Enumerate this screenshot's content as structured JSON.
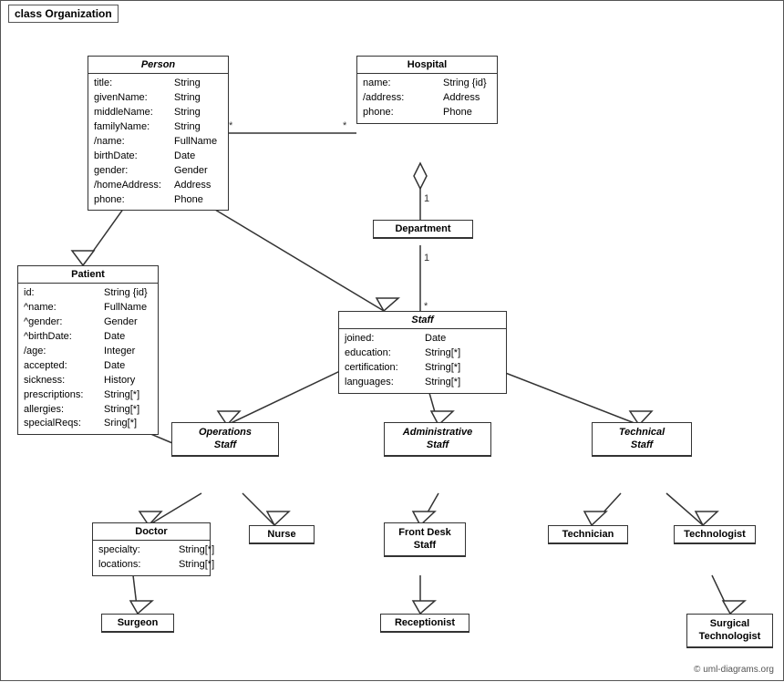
{
  "diagram": {
    "title": "class Organization",
    "copyright": "© uml-diagrams.org",
    "classes": {
      "person": {
        "name": "Person",
        "italic": true,
        "attrs": [
          {
            "name": "title:",
            "type": "String"
          },
          {
            "name": "givenName:",
            "type": "String"
          },
          {
            "name": "middleName:",
            "type": "String"
          },
          {
            "name": "familyName:",
            "type": "String"
          },
          {
            "name": "/name:",
            "type": "FullName"
          },
          {
            "name": "birthDate:",
            "type": "Date"
          },
          {
            "name": "gender:",
            "type": "Gender"
          },
          {
            "name": "/homeAddress:",
            "type": "Address"
          },
          {
            "name": "phone:",
            "type": "Phone"
          }
        ]
      },
      "hospital": {
        "name": "Hospital",
        "italic": false,
        "attrs": [
          {
            "name": "name:",
            "type": "String {id}"
          },
          {
            "name": "/address:",
            "type": "Address"
          },
          {
            "name": "phone:",
            "type": "Phone"
          }
        ]
      },
      "department": {
        "name": "Department",
        "italic": false,
        "attrs": []
      },
      "staff": {
        "name": "Staff",
        "italic": true,
        "attrs": [
          {
            "name": "joined:",
            "type": "Date"
          },
          {
            "name": "education:",
            "type": "String[*]"
          },
          {
            "name": "certification:",
            "type": "String[*]"
          },
          {
            "name": "languages:",
            "type": "String[*]"
          }
        ]
      },
      "patient": {
        "name": "Patient",
        "italic": false,
        "attrs": [
          {
            "name": "id:",
            "type": "String {id}"
          },
          {
            "name": "^name:",
            "type": "FullName"
          },
          {
            "name": "^gender:",
            "type": "Gender"
          },
          {
            "name": "^birthDate:",
            "type": "Date"
          },
          {
            "name": "/age:",
            "type": "Integer"
          },
          {
            "name": "accepted:",
            "type": "Date"
          },
          {
            "name": "sickness:",
            "type": "History"
          },
          {
            "name": "prescriptions:",
            "type": "String[*]"
          },
          {
            "name": "allergies:",
            "type": "String[*]"
          },
          {
            "name": "specialReqs:",
            "type": "Sring[*]"
          }
        ]
      },
      "operations_staff": {
        "name": "Operations\nStaff",
        "italic": true,
        "attrs": []
      },
      "administrative_staff": {
        "name": "Administrative\nStaff",
        "italic": true,
        "attrs": []
      },
      "technical_staff": {
        "name": "Technical\nStaff",
        "italic": true,
        "attrs": []
      },
      "doctor": {
        "name": "Doctor",
        "italic": false,
        "attrs": [
          {
            "name": "specialty:",
            "type": "String[*]"
          },
          {
            "name": "locations:",
            "type": "String[*]"
          }
        ]
      },
      "nurse": {
        "name": "Nurse",
        "italic": false,
        "attrs": []
      },
      "front_desk_staff": {
        "name": "Front Desk\nStaff",
        "italic": false,
        "attrs": []
      },
      "technician": {
        "name": "Technician",
        "italic": false,
        "attrs": []
      },
      "technologist": {
        "name": "Technologist",
        "italic": false,
        "attrs": []
      },
      "surgeon": {
        "name": "Surgeon",
        "italic": false,
        "attrs": []
      },
      "receptionist": {
        "name": "Receptionist",
        "italic": false,
        "attrs": []
      },
      "surgical_technologist": {
        "name": "Surgical\nTechnologist",
        "italic": false,
        "attrs": []
      }
    }
  }
}
